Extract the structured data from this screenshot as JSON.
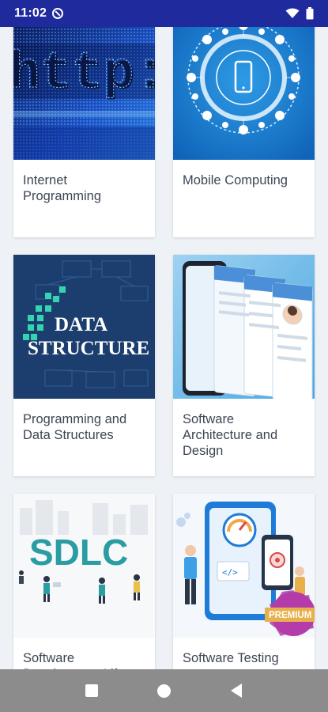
{
  "status_bar": {
    "time": "11:02"
  },
  "courses": [
    {
      "title": "Internet Programming",
      "image": "http-address-bar-image"
    },
    {
      "title": "Mobile Computing",
      "image": "mobile-network-circle-image"
    },
    {
      "title": "Programming and Data Structures",
      "image": "data-structure-image",
      "image_text_1": "DATA",
      "image_text_2": "STRUCTURE"
    },
    {
      "title": "Software Architecture and Design",
      "image": "app-screens-phone-image"
    },
    {
      "title": "Software Development Life",
      "image": "sdlc-illustration-image",
      "image_text": "SDLC"
    },
    {
      "title": "Software Testing",
      "image": "testing-devices-image",
      "badge": "PREMIUM"
    }
  ],
  "colors": {
    "status_bar": "#1f2a9c",
    "nav_bar": "#8c8c8c",
    "premium_badge": "#b43caa",
    "sdlc_text": "#2a9da3"
  },
  "icons": [
    "wifi-icon",
    "battery-icon",
    "dnd-icon",
    "recents-icon",
    "home-icon",
    "back-icon"
  ]
}
